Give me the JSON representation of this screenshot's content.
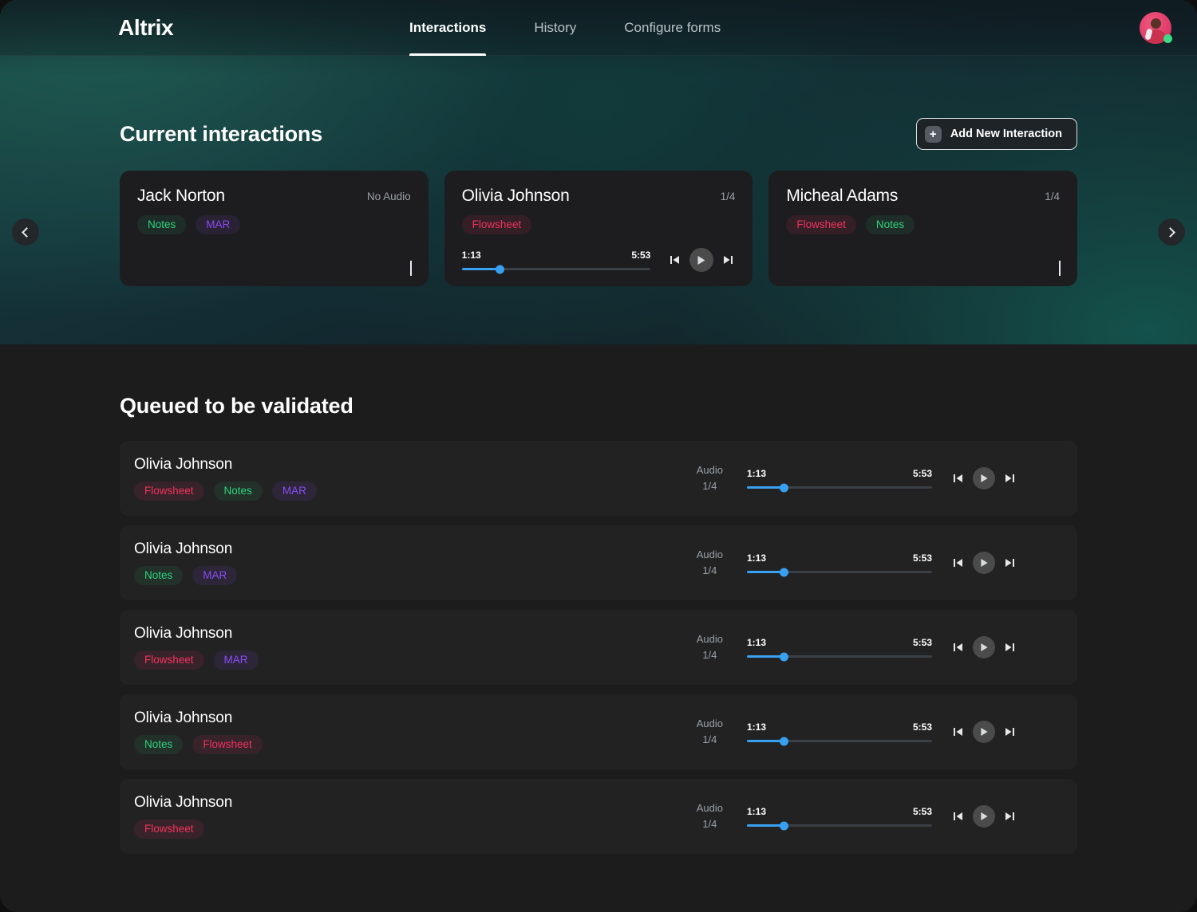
{
  "app": {
    "brand": "Altrix"
  },
  "nav": {
    "tabs": [
      {
        "label": "Interactions",
        "active": true
      },
      {
        "label": "History",
        "active": false
      },
      {
        "label": "Configure forms",
        "active": false
      }
    ],
    "avatar_icon": "user-avatar",
    "status_icon": "online-status-dot"
  },
  "current": {
    "title": "Current interactions",
    "add_button": {
      "label": "Add New Interaction",
      "icon": "plus-icon"
    },
    "prev_icon": "chevron-left-icon",
    "next_icon": "chevron-right-icon",
    "cards": [
      {
        "name": "Jack Norton",
        "meta": "No Audio",
        "tags": [
          {
            "label": "Notes",
            "type": "notes"
          },
          {
            "label": "MAR",
            "type": "mar"
          }
        ],
        "has_player": false,
        "open_icon": "chevron-right-icon"
      },
      {
        "name": "Olivia Johnson",
        "meta": "1/4",
        "tags": [
          {
            "label": "Flowsheet",
            "type": "flowsheet"
          }
        ],
        "has_player": true,
        "player": {
          "current_time": "1:13",
          "total_time": "5:53",
          "progress_percent": 20,
          "prev_icon": "skip-previous-icon",
          "play_icon": "play-icon",
          "next_icon": "skip-next-icon"
        }
      },
      {
        "name": "Micheal Adams",
        "meta": "1/4",
        "tags": [
          {
            "label": "Flowsheet",
            "type": "flowsheet"
          },
          {
            "label": "Notes",
            "type": "notes"
          }
        ],
        "has_player": false,
        "open_icon": "chevron-right-icon"
      }
    ]
  },
  "queue": {
    "title": "Queued to be validated",
    "audio_label": "Audio",
    "rows": [
      {
        "name": "Olivia Johnson",
        "audio_label": "Audio",
        "audio_count": "1/4",
        "tags": [
          {
            "label": "Flowsheet",
            "type": "flowsheet"
          },
          {
            "label": "Notes",
            "type": "notes"
          },
          {
            "label": "MAR",
            "type": "mar"
          }
        ],
        "player": {
          "current_time": "1:13",
          "total_time": "5:53",
          "progress_percent": 20
        }
      },
      {
        "name": "Olivia Johnson",
        "audio_label": "Audio",
        "audio_count": "1/4",
        "tags": [
          {
            "label": "Notes",
            "type": "notes"
          },
          {
            "label": "MAR",
            "type": "mar"
          }
        ],
        "player": {
          "current_time": "1:13",
          "total_time": "5:53",
          "progress_percent": 20
        }
      },
      {
        "name": "Olivia Johnson",
        "audio_label": "Audio",
        "audio_count": "1/4",
        "tags": [
          {
            "label": "Flowsheet",
            "type": "flowsheet"
          },
          {
            "label": "MAR",
            "type": "mar"
          }
        ],
        "player": {
          "current_time": "1:13",
          "total_time": "5:53",
          "progress_percent": 20
        }
      },
      {
        "name": "Olivia Johnson",
        "audio_label": "Audio",
        "audio_count": "1/4",
        "tags": [
          {
            "label": "Notes",
            "type": "notes"
          },
          {
            "label": "Flowsheet",
            "type": "flowsheet"
          }
        ],
        "player": {
          "current_time": "1:13",
          "total_time": "5:53",
          "progress_percent": 20
        }
      },
      {
        "name": "Olivia Johnson",
        "audio_label": "Audio",
        "audio_count": "1/4",
        "tags": [
          {
            "label": "Flowsheet",
            "type": "flowsheet"
          }
        ],
        "player": {
          "current_time": "1:13",
          "total_time": "5:53",
          "progress_percent": 20
        }
      }
    ]
  },
  "colors": {
    "notes": "#2fd37f",
    "mar": "#8b4bf5",
    "flowsheet": "#f1335f",
    "seek": "#38a0f0",
    "accent_teal": "#1f5a52"
  }
}
